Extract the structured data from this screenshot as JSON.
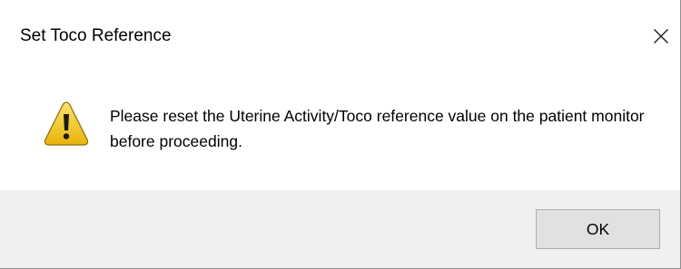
{
  "dialog": {
    "title": "Set Toco Reference",
    "message": "Please reset the Uterine Activity/Toco reference value on the patient monitor before proceeding.",
    "icon": "warning-icon",
    "close_icon": "close-icon",
    "buttons": {
      "ok_label": "OK"
    }
  },
  "colors": {
    "warning_fill": "#f5c518",
    "footer_background": "#f0f0f0",
    "button_background": "#e1e1e1"
  }
}
